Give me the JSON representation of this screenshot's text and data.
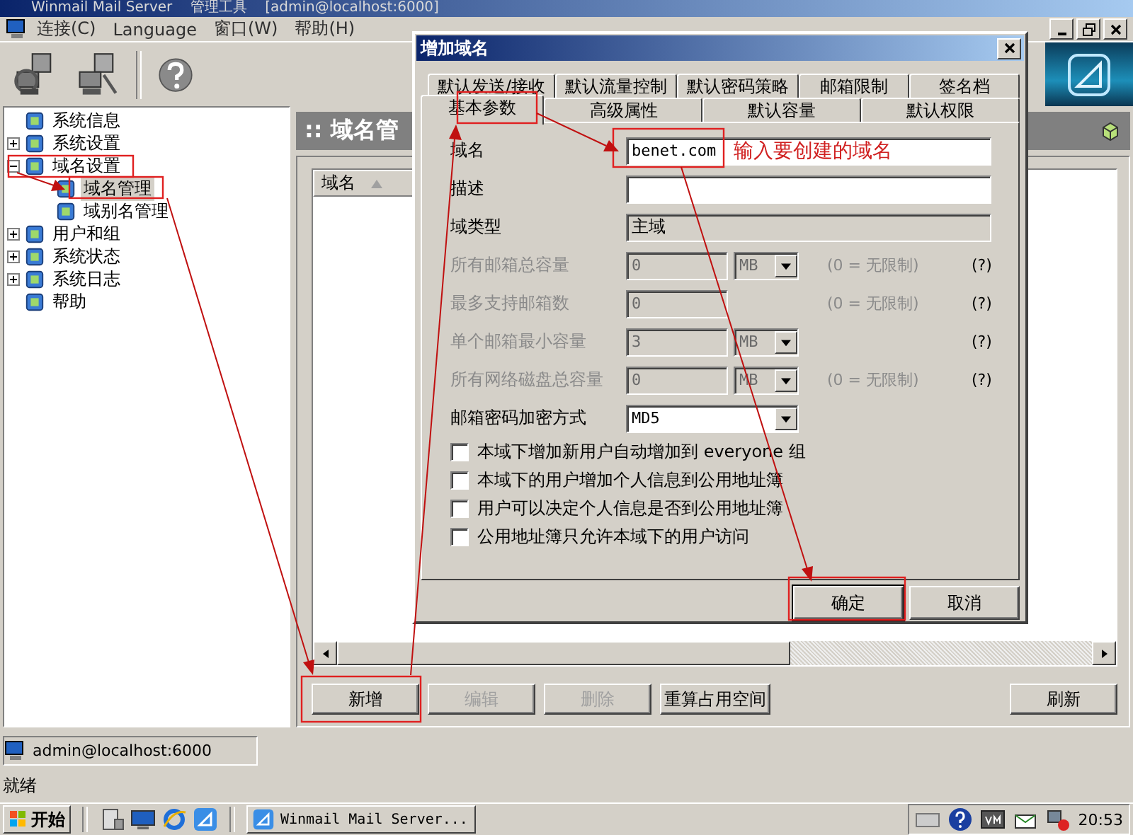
{
  "window": {
    "title": "Winmail Mail Server    管理工具    [admin@localhost:6000]"
  },
  "menu": [
    "连接(C)",
    "Language",
    "窗口(W)",
    "帮助(H)"
  ],
  "tree": [
    {
      "label": "系统信息",
      "selected": false
    },
    {
      "label": "系统设置",
      "selected": false,
      "expanded": false
    },
    {
      "label": "域名设置",
      "selected": false,
      "expanded": true,
      "children": [
        {
          "label": "域名管理",
          "selected": true
        },
        {
          "label": "域别名管理",
          "selected": false
        }
      ]
    },
    {
      "label": "用户和组",
      "selected": false,
      "expanded": false
    },
    {
      "label": "系统状态",
      "selected": false,
      "expanded": false
    },
    {
      "label": "系统日志",
      "selected": false,
      "expanded": false
    },
    {
      "label": "帮助",
      "selected": false
    }
  ],
  "panel": {
    "title": ":: 域名管",
    "columns": [
      "域名"
    ],
    "buttons": [
      {
        "label": "新增",
        "disabled": false
      },
      {
        "label": "编辑",
        "disabled": true
      },
      {
        "label": "删除",
        "disabled": true
      },
      {
        "label": "重算占用空间",
        "disabled": false
      }
    ],
    "refresh_button": "刷新"
  },
  "connection": "admin@localhost:6000",
  "status": "就绪",
  "dialog": {
    "title": "增加域名",
    "tabs_back": [
      {
        "label": "默认发送/接收",
        "selected": false
      },
      {
        "label": "默认流量控制",
        "selected": false
      },
      {
        "label": "默认密码策略",
        "selected": false
      },
      {
        "label": "邮箱限制",
        "selected": false
      },
      {
        "label": "签名档",
        "selected": false
      }
    ],
    "tabs_front": [
      {
        "label": "基本参数",
        "selected": true
      },
      {
        "label": "高级属性",
        "selected": false
      },
      {
        "label": "默认容量",
        "selected": false
      },
      {
        "label": "默认权限",
        "selected": false
      }
    ],
    "fields": [
      {
        "kind": "text",
        "label": "域名",
        "value": "benet.com",
        "disabled": false
      },
      {
        "kind": "text",
        "label": "描述",
        "disabled": false
      },
      {
        "kind": "readonly",
        "label": "域类型",
        "value": "主域",
        "disabled": false
      },
      {
        "kind": "quota",
        "label": "所有邮箱总容量",
        "value": "0",
        "unit": "MB",
        "note": "(0 = 无限制)",
        "help": "(?)",
        "disabled": true
      },
      {
        "kind": "quota",
        "label": "最多支持邮箱数",
        "value": "0",
        "note": "(0 = 无限制)",
        "help": "(?)",
        "disabled": true
      },
      {
        "kind": "quota",
        "label": "单个邮箱最小容量",
        "value": "3",
        "unit": "MB",
        "help": "(?)",
        "disabled": true
      },
      {
        "kind": "quota",
        "label": "所有网络磁盘总容量",
        "value": "0",
        "unit": "MB",
        "note": "(0 = 无限制)",
        "help": "(?)",
        "disabled": true
      },
      {
        "kind": "select",
        "label": "邮箱密码加密方式",
        "value": "MD5",
        "disabled": false
      }
    ],
    "checkboxes": [
      {
        "label": "本域下增加新用户自动增加到 everyone 组",
        "checked": false
      },
      {
        "label": "本域下的用户增加个人信息到公用地址簿",
        "checked": false
      },
      {
        "label": "用户可以决定个人信息是否到公用地址簿",
        "checked": false
      },
      {
        "label": "公用地址簿只允许本域下的用户访问",
        "checked": false
      }
    ],
    "buttons": [
      "确定",
      "取消"
    ],
    "annotation": "输入要创建的域名"
  },
  "taskbar": {
    "start": "开始",
    "tasks": [
      {
        "label": "Winmail Mail Server...",
        "selected": false
      }
    ],
    "clock": "20:53"
  }
}
